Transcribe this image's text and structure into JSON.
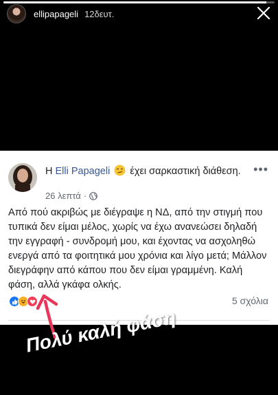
{
  "story": {
    "progress": 0.97,
    "username": "ellipapageli",
    "time_ago": "12δευτ.",
    "close_icon": "close-icon"
  },
  "post": {
    "name": "Elli Papageli",
    "prefix": "Η",
    "feeling": "έχει σαρκαστική διάθεση.",
    "feeling_emoji": "smirk-emoji",
    "time": "26 λεπτά",
    "privacy_icon": "globe-icon",
    "more_icon": "more-icon",
    "body": "Από πού ακριβώς με διέγραψε η ΝΔ, από την στιγμή που τυπικά δεν είμαι μέλος, χωρίς να έχω ανανεώσει δηλαδή την εγγραφή - συνδρομή μου, και έχοντας να ασχοληθώ ενεργά από τα φοιτητικά μου χρόνια και λίγο μετά; Μάλλον διεγράφην από κάπου που δεν είμαι γραμμένη. Καλή φάση, αλλά γκάφα ολκής.",
    "reactions": [
      "like-icon",
      "haha-icon",
      "love-icon"
    ],
    "comments": "5 σχόλια"
  },
  "overlay": {
    "caption": "Πολύ καλή φάση",
    "arrow_color": "#e8375a"
  },
  "colors": {
    "like": "#1877f2",
    "haha": "#f7b125",
    "love": "#f33e58"
  }
}
